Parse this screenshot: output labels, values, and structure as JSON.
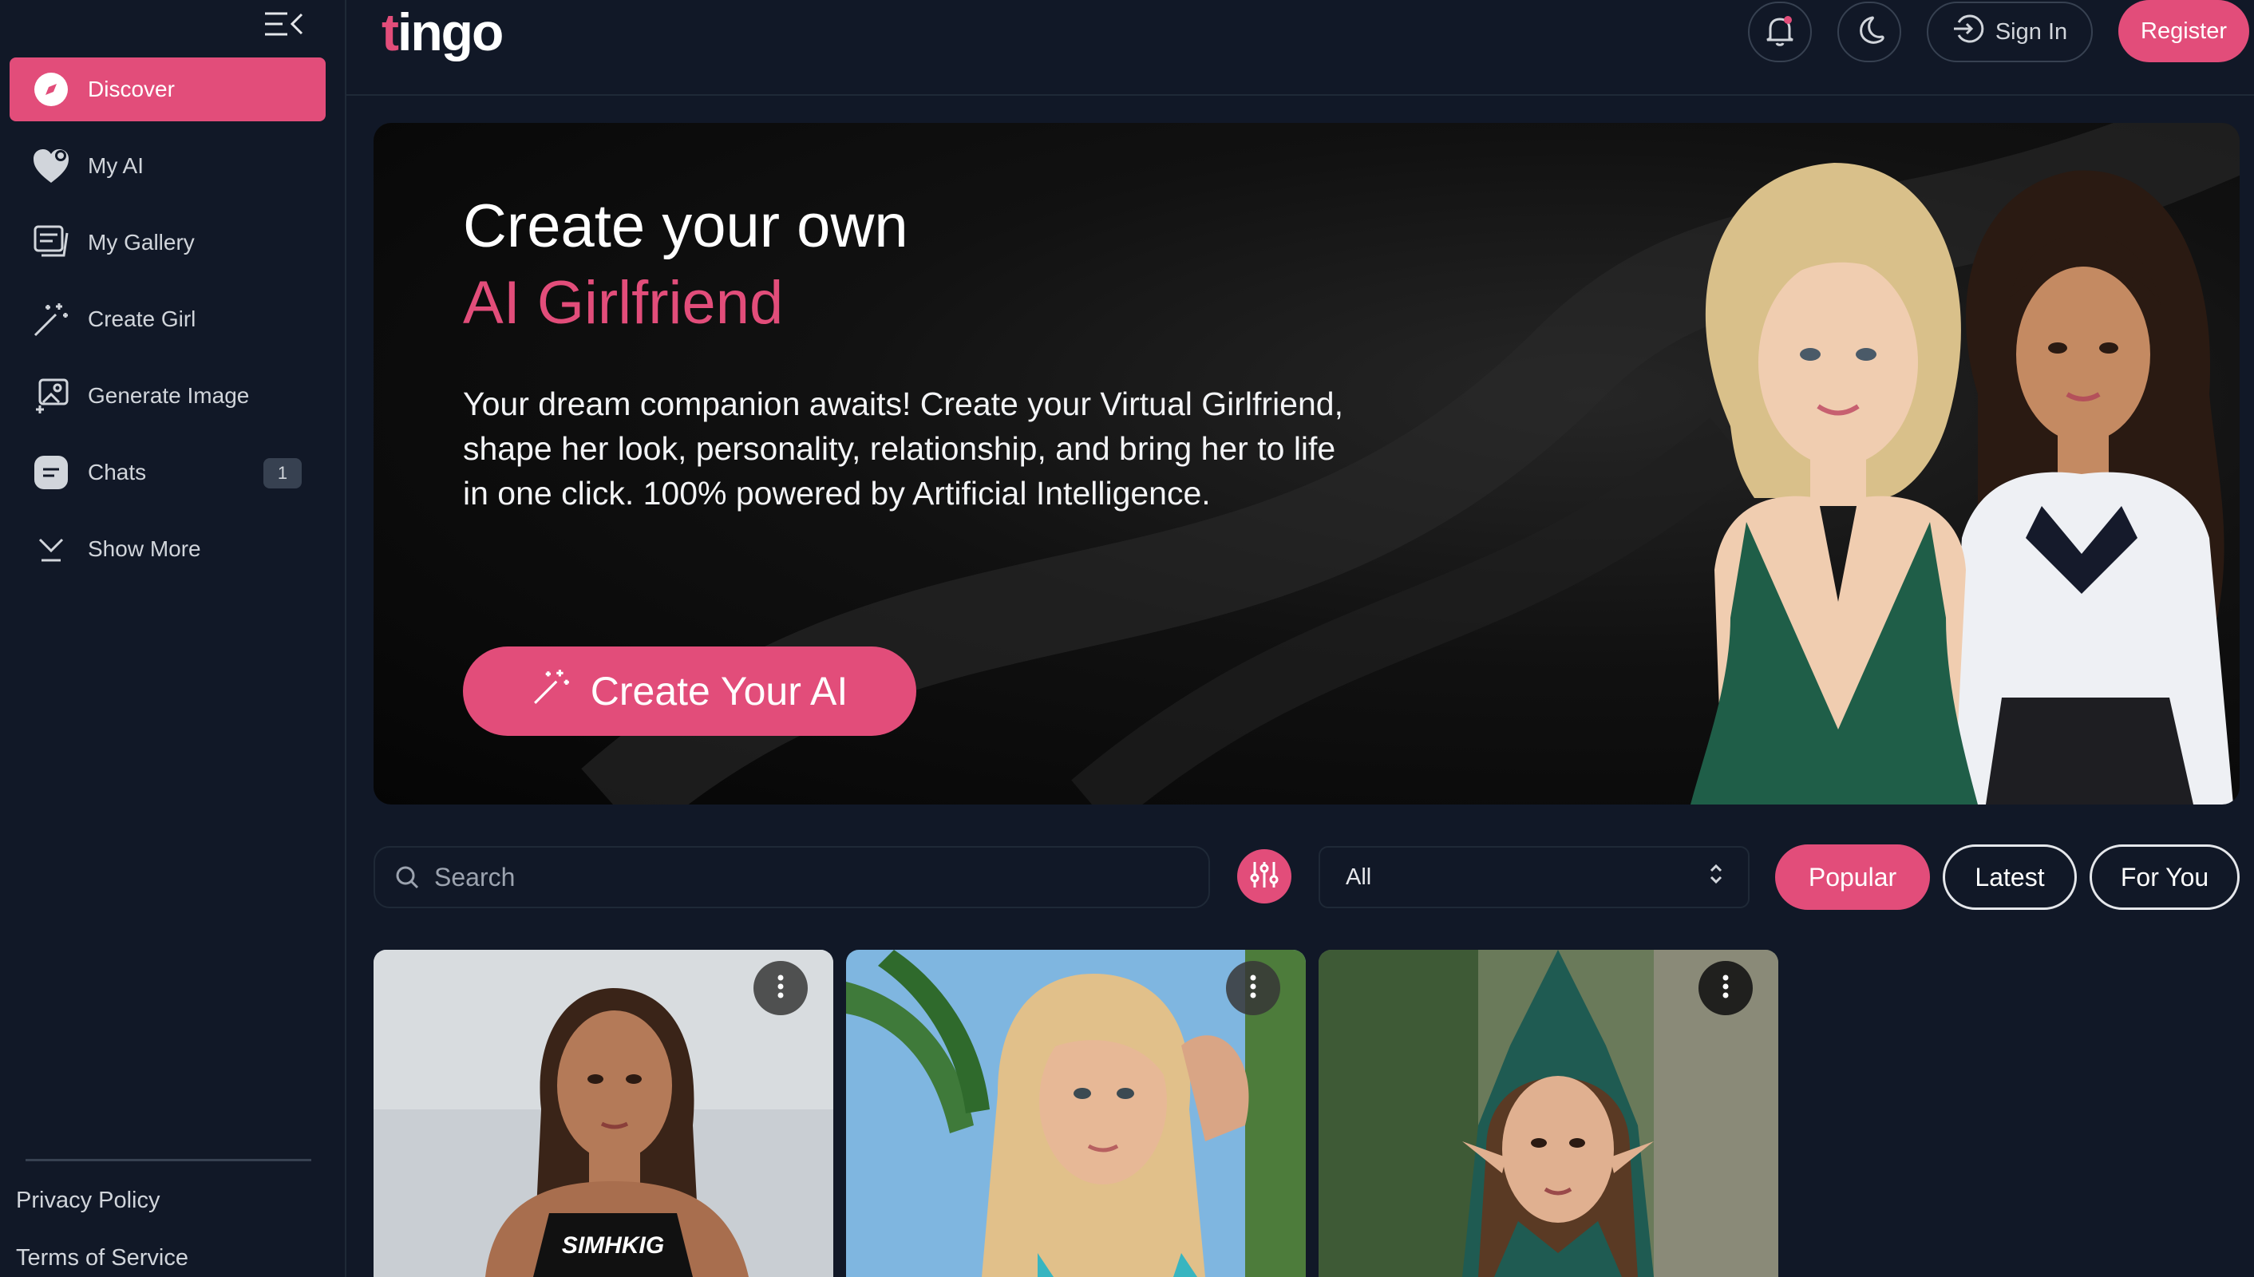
{
  "app": {
    "logo_text": "tingo",
    "brand_color": "#e24d7a"
  },
  "sidebar": {
    "items": [
      {
        "label": "Discover",
        "icon": "compass-icon",
        "active": true
      },
      {
        "label": "My AI",
        "icon": "heart-icon"
      },
      {
        "label": "My Gallery",
        "icon": "gallery-icon"
      },
      {
        "label": "Create Girl",
        "icon": "magic-wand-icon"
      },
      {
        "label": "Generate Image",
        "icon": "image-plus-icon"
      },
      {
        "label": "Chats",
        "icon": "chat-icon",
        "badge": "1"
      },
      {
        "label": "Show More",
        "icon": "chevron-down-icon"
      }
    ],
    "footer": {
      "privacy": "Privacy Policy",
      "terms": "Terms of Service"
    }
  },
  "header": {
    "signin_label": "Sign In",
    "register_label": "Register"
  },
  "hero": {
    "title_line1": "Create your own",
    "title_line2": "AI Girlfriend",
    "description": "Your dream companion awaits! Create your Virtual Girlfriend, shape her look, personality, relationship, and bring her to life in one click. 100% powered by Artificial Intelligence.",
    "cta_label": "Create Your AI"
  },
  "filters": {
    "search_placeholder": "Search",
    "select_value": "All",
    "tabs": [
      {
        "label": "Popular",
        "active": true
      },
      {
        "label": "Latest"
      },
      {
        "label": "For You"
      }
    ]
  },
  "cards": [
    {
      "shirt_text": "SIMHKIG"
    },
    {},
    {}
  ]
}
